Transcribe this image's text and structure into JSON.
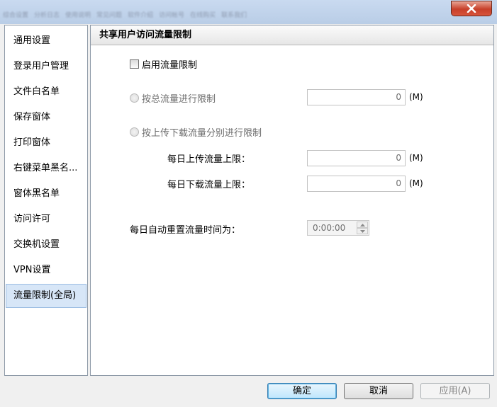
{
  "window": {
    "blurred_tabs": [
      "综合设置",
      "分析日志",
      "使用说明",
      "常见问题",
      "软件介绍",
      "访问帐号",
      "在线购买",
      "联系我们"
    ]
  },
  "sidebar": {
    "items": [
      {
        "label": "通用设置"
      },
      {
        "label": "登录用户管理"
      },
      {
        "label": "文件白名单"
      },
      {
        "label": "保存窗体"
      },
      {
        "label": "打印窗体"
      },
      {
        "label": "右键菜单黑名..."
      },
      {
        "label": "窗体黑名单"
      },
      {
        "label": "访问许可"
      },
      {
        "label": "交换机设置"
      },
      {
        "label": "VPN设置"
      },
      {
        "label": "流量限制(全局)"
      }
    ],
    "selected_index": 10
  },
  "panel": {
    "title": "共享用户访问流量限制",
    "enable_limit": {
      "label": "启用流量限制",
      "checked": false
    },
    "total_limit": {
      "label": "按总流量进行限制",
      "value": "0",
      "unit": "(M)"
    },
    "separate_limit": {
      "label": "按上传下载流量分别进行限制"
    },
    "upload_limit": {
      "label": "每日上传流量上限：",
      "value": "0",
      "unit": "(M)"
    },
    "download_limit": {
      "label": "每日下载流量上限：",
      "value": "0",
      "unit": "(M)"
    },
    "reset_time": {
      "label": "每日自动重置流量时间为：",
      "value": "0:00:00"
    }
  },
  "buttons": {
    "ok": "确定",
    "cancel": "取消",
    "apply": "应用(A)"
  }
}
